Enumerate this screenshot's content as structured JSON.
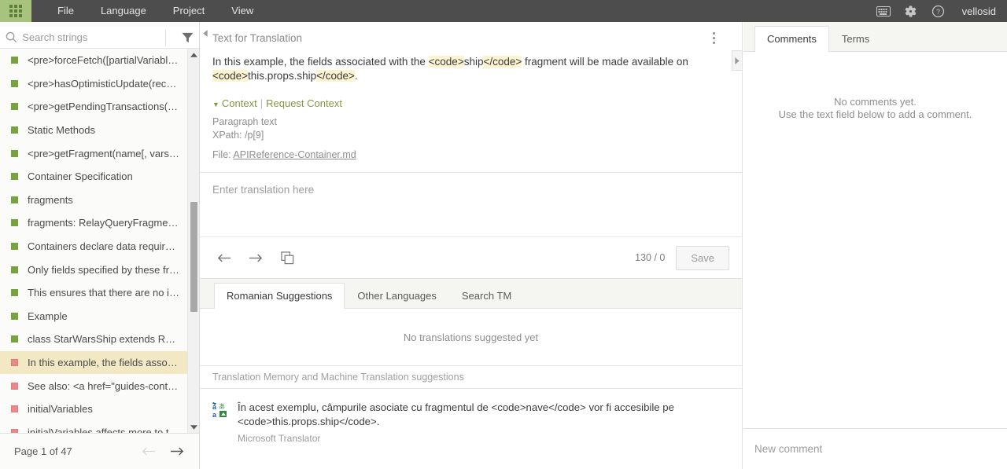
{
  "topbar": {
    "launcher_name": "apps-launcher",
    "menu": [
      {
        "label": "File"
      },
      {
        "label": "Language"
      },
      {
        "label": "Project"
      },
      {
        "label": "View"
      }
    ],
    "icons": [
      {
        "name": "keyboard-icon"
      },
      {
        "name": "gear-icon"
      },
      {
        "name": "help-icon"
      }
    ],
    "username": "vellosid"
  },
  "sidebar": {
    "search": {
      "value": "",
      "placeholder": "Search strings"
    },
    "filter_icon": "filter-icon",
    "items": [
      {
        "label": "<pre>forceFetch([partialVariables[, o...",
        "status": "translated",
        "selected": false
      },
      {
        "label": "<pre>hasOptimisticUpdate(record)<...",
        "status": "translated",
        "selected": false
      },
      {
        "label": "<pre>getPendingTransactions(recor...",
        "status": "translated",
        "selected": false
      },
      {
        "label": "Static Methods",
        "status": "translated",
        "selected": false
      },
      {
        "label": "<pre>getFragment(name[, vars])</pr...",
        "status": "translated",
        "selected": false
      },
      {
        "label": "Container Specification",
        "status": "translated",
        "selected": false
      },
      {
        "label": "fragments",
        "status": "translated",
        "selected": false
      },
      {
        "label": "fragments: RelayQueryFragments&lt...",
        "status": "translated",
        "selected": false
      },
      {
        "label": "Containers declare data requiremen...",
        "status": "translated",
        "selected": false
      },
      {
        "label": "Only fields specified by these fragm...",
        "status": "translated",
        "selected": false
      },
      {
        "label": "This ensures that there are no impli...",
        "status": "translated",
        "selected": false
      },
      {
        "label": "Example",
        "status": "translated",
        "selected": false
      },
      {
        "label": "class StarWarsShip extends React.C...",
        "status": "translated",
        "selected": false
      },
      {
        "label": "In this example, the fields associate...",
        "status": "untranslated",
        "selected": true
      },
      {
        "label": "See also: <a href=\"guides-containers...",
        "status": "untranslated",
        "selected": false
      },
      {
        "label": "initialVariables",
        "status": "untranslated",
        "selected": false
      },
      {
        "label": "initialVariables affects more to the i...",
        "status": "untranslated",
        "selected": false
      }
    ],
    "pager": {
      "label": "Page 1 of 47",
      "prev_name": "prev-page-button",
      "next_name": "next-page-button"
    }
  },
  "center": {
    "source_title": "Text for Translation",
    "source_segments": [
      {
        "text": "In this example, the fields associated with the ",
        "tag": false
      },
      {
        "text": "<code>",
        "tag": true
      },
      {
        "text": "ship",
        "tag": false
      },
      {
        "text": "</code>",
        "tag": true
      },
      {
        "text": " fragment will be made available on ",
        "tag": false
      },
      {
        "text": "<code>",
        "tag": true
      },
      {
        "text": "this.props.ship",
        "tag": false
      },
      {
        "text": "</code>",
        "tag": true
      },
      {
        "text": ".",
        "tag": false
      }
    ],
    "context": {
      "toggle_label": "Context",
      "request_label": "Request Context",
      "type": "Paragraph text",
      "xpath": "XPath: /p[9]",
      "file_prefix": "File: ",
      "file_name": "APIReference-Container.md"
    },
    "editor": {
      "placeholder": "Enter translation here",
      "value": ""
    },
    "toolbar": {
      "prev_name": "previous-string-button",
      "next_name": "next-string-button",
      "copy_name": "copy-source-button",
      "char_count": "130 / 0",
      "save_label": "Save"
    },
    "tabs": [
      {
        "label": "Romanian Suggestions",
        "active": true
      },
      {
        "label": "Other Languages",
        "active": false
      },
      {
        "label": "Search TM",
        "active": false
      }
    ],
    "suggestions_empty": "No translations suggested yet",
    "tm_header": "Translation Memory and Machine Translation suggestions",
    "tm_entries": [
      {
        "text": "În acest exemplu, câmpurile asociate cu fragmentul de <code>nave</code> vor fi accesibile pe <code>this.props.ship</code>.",
        "source": "Microsoft Translator",
        "icon": "translate-icon"
      }
    ]
  },
  "right": {
    "tabs": [
      {
        "label": "Comments",
        "active": true
      },
      {
        "label": "Terms",
        "active": false
      }
    ],
    "empty_line1": "No comments yet.",
    "empty_line2": "Use the text field below to add a comment.",
    "new_comment_placeholder": "New comment"
  },
  "colors": {
    "topbar": "#4d4d4d",
    "launcher": "#a8c37e",
    "accent_green": "#7f9a40",
    "selected_row": "#f2e9c4",
    "tag_highlight": "#fcf3d0",
    "status_translated": "#76a23f",
    "status_untranslated": "#e98a8a"
  }
}
